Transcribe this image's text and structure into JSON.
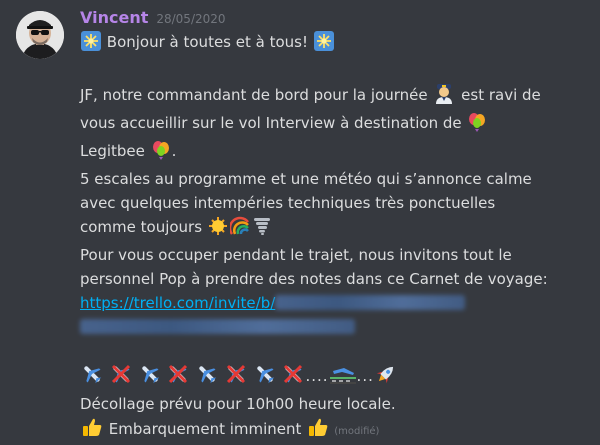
{
  "message": {
    "author": "Vincent",
    "timestamp": "28/05/2020",
    "line1": "Bonjour à toutes et à tous!",
    "line2a": "JF, notre commandant de bord pour la journée",
    "line2b": "est ravi de",
    "line3": "vous accueillir sur le vol Interview à destination de",
    "line4": "Legitbee",
    "line4_end": ".",
    "line5": "5 escales au programme et une météo qui s’annonce calme",
    "line6": "avec quelques intempéries techniques très ponctuelles",
    "line7": "comme toujours",
    "line8": "Pour vous occuper pendant le trajet, nous invitons tout le",
    "line9": "personnel Pop à prendre des notes dans ce Carnet de voyage:",
    "link_visible": "https://trello.com/invite/b/",
    "ellipsis1": "....",
    "ellipsis2": "...",
    "line10": "Décollage prévu pour 10h00 heure locale.",
    "line11": "Embarquement imminent",
    "edited": "(modifié)"
  },
  "colors": {
    "background": "#36393f",
    "author": "#b685e8",
    "link": "#00b0f4",
    "text": "#dcddde",
    "muted": "#72767d"
  },
  "icons": [
    "sparkle-icon",
    "pilot-icon",
    "balloon-icon",
    "sun-icon",
    "rainbow-icon",
    "tornado-icon",
    "airplane-icon",
    "crossed-airplane-icon",
    "landing-icon",
    "rocket-icon",
    "thumbs-up-icon"
  ]
}
